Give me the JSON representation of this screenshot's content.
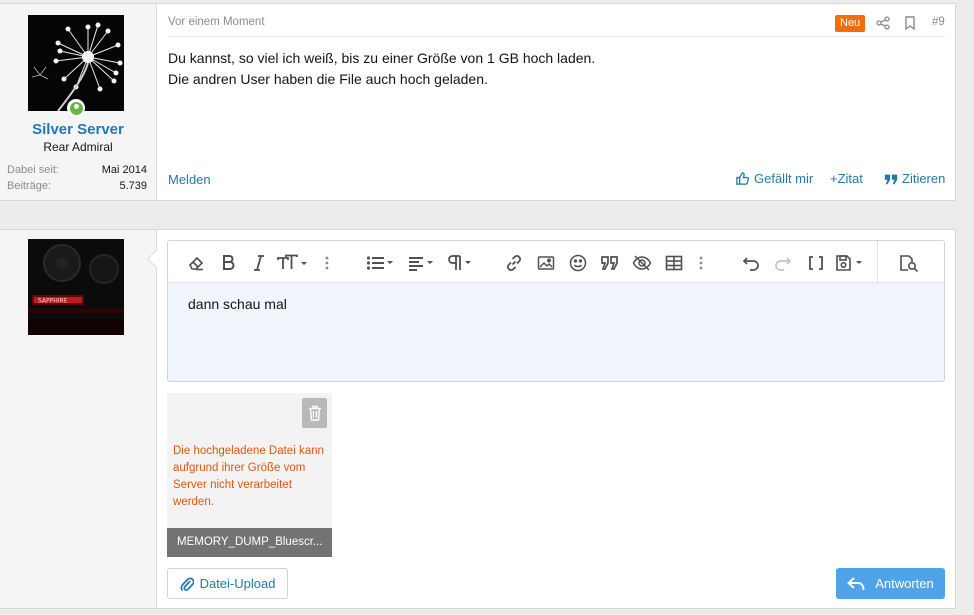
{
  "post": {
    "timestamp": "Vor einem Moment",
    "badge": "Neu",
    "number": "#9",
    "lines": [
      "Du kannst, so viel ich weiß, bis zu einer Größe von 1 GB hoch laden.",
      "Die andren User haben die File auch hoch geladen."
    ],
    "report_label": "Melden",
    "like_label": "Gefällt mir",
    "quote_label": "+Zitat",
    "cite_label": "Zitieren",
    "author": {
      "name": "Silver Server",
      "title": "Rear Admiral",
      "stats": [
        {
          "label": "Dabei seit:",
          "value": "Mai 2014"
        },
        {
          "label": "Beiträge:",
          "value": "5.739"
        }
      ]
    }
  },
  "editor": {
    "content": "dann schau mal"
  },
  "attachment": {
    "error": "Die hochgeladene Datei kann aufgrund ihrer Größe vom Server nicht verarbeitet werden.",
    "filename": "MEMORY_DUMP_Bluescr..."
  },
  "upload_label": "Datei-Upload",
  "reply_label": "Antworten",
  "colors": {
    "accent": "#2577b1",
    "badge": "#f26e0d",
    "error": "#e0560f",
    "reply_button": "#4fa3e8",
    "online": "#63b845"
  }
}
